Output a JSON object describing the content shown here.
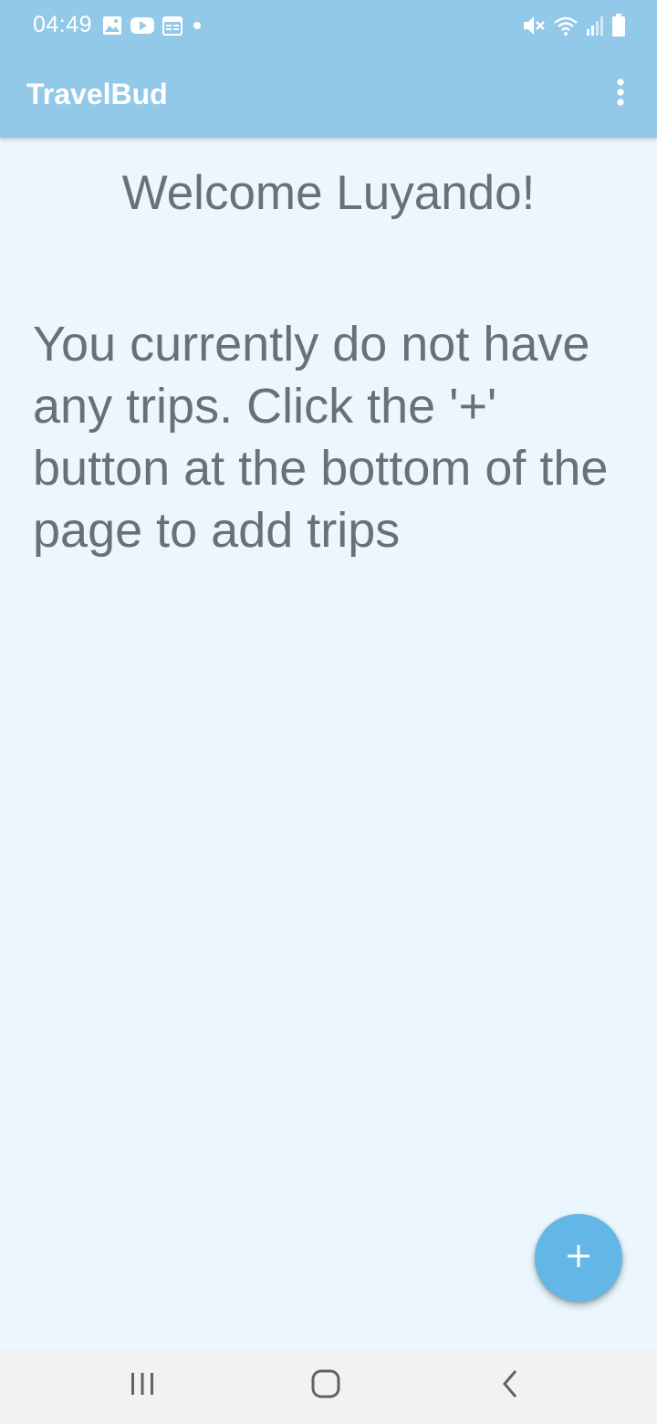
{
  "status_bar": {
    "time": "04:49",
    "left_icons": [
      "image-icon",
      "youtube-icon",
      "calendar-icon",
      "dot-icon"
    ],
    "right_icons": [
      "mute-icon",
      "wifi-icon",
      "signal-icon",
      "battery-icon"
    ]
  },
  "app_bar": {
    "title": "TravelBud",
    "overflow_icon": "more-vert-icon"
  },
  "main": {
    "welcome": "Welcome Luyando!",
    "empty_message": "You currently do not have any trips. Click the '+' button at the bottom of the page to add trips"
  },
  "fab": {
    "icon": "plus-icon"
  },
  "nav_bar": {
    "buttons": [
      "recents-icon",
      "home-icon",
      "back-icon"
    ]
  },
  "colors": {
    "app_bar": "#93c9e8",
    "background": "#ebf6fe",
    "text": "#6b7076",
    "fab": "#63b7e6",
    "nav_bar": "#f2f2f2"
  }
}
